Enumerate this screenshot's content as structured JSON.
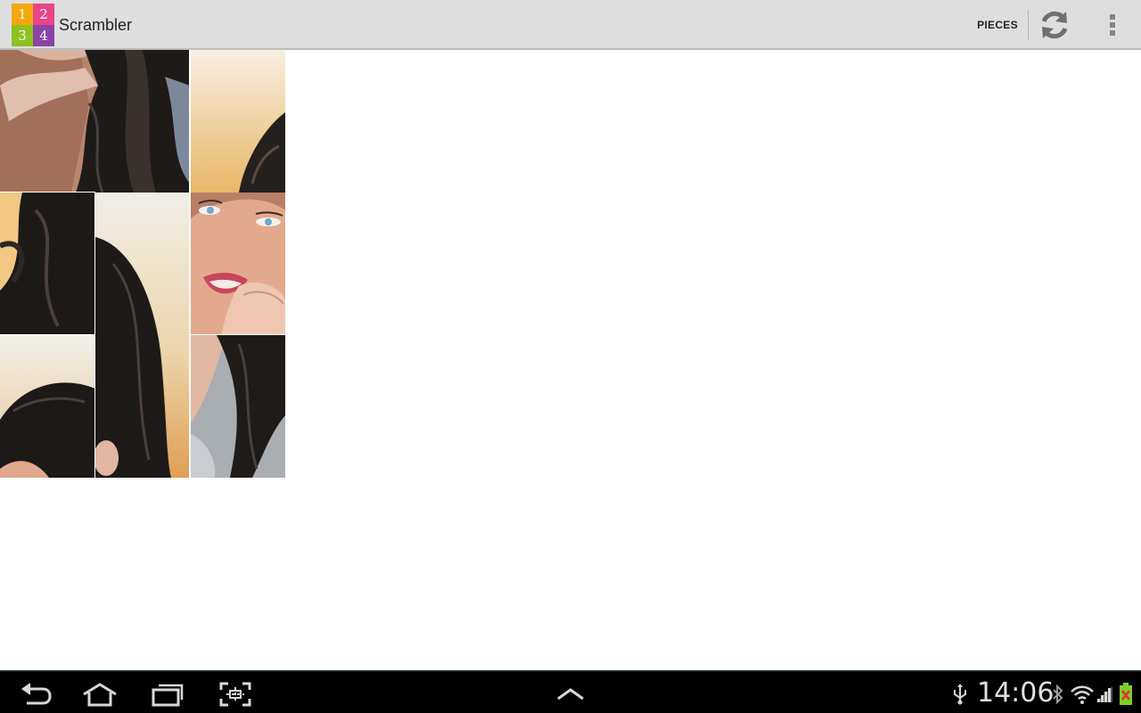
{
  "app": {
    "title": "Scrambler",
    "logo_digits": [
      "1",
      "2",
      "3",
      "4"
    ],
    "logo_colors": [
      "#f5a80e",
      "#e8458b",
      "#8dc21f",
      "#8a44a8"
    ]
  },
  "action_bar": {
    "pieces_label": "PIECES",
    "refresh_icon": "refresh-icon",
    "overflow_icon": "overflow-menu-icon"
  },
  "puzzle": {
    "grid": "3x3",
    "pieces": [
      {
        "id": "piece-1",
        "content": "hand in dark hair"
      },
      {
        "id": "piece-2",
        "content": "warm sky with dark hair"
      },
      {
        "id": "piece-3",
        "content": "dark wavy hair"
      },
      {
        "id": "piece-4",
        "content": "pale sky with dark hair"
      },
      {
        "id": "piece-5",
        "content": "face with blue eyes"
      },
      {
        "id": "piece-6",
        "content": "top of head"
      },
      {
        "id": "piece-7",
        "content": "hair over grey shirt"
      }
    ]
  },
  "system_bar": {
    "time": "14:06",
    "nav_icons": [
      "back-icon",
      "home-icon",
      "recent-apps-icon",
      "screenshot-icon",
      "up-arrow-icon"
    ],
    "status_icons": [
      "usb-icon",
      "bluetooth-icon",
      "wifi-icon",
      "signal-icon",
      "battery-icon"
    ]
  }
}
